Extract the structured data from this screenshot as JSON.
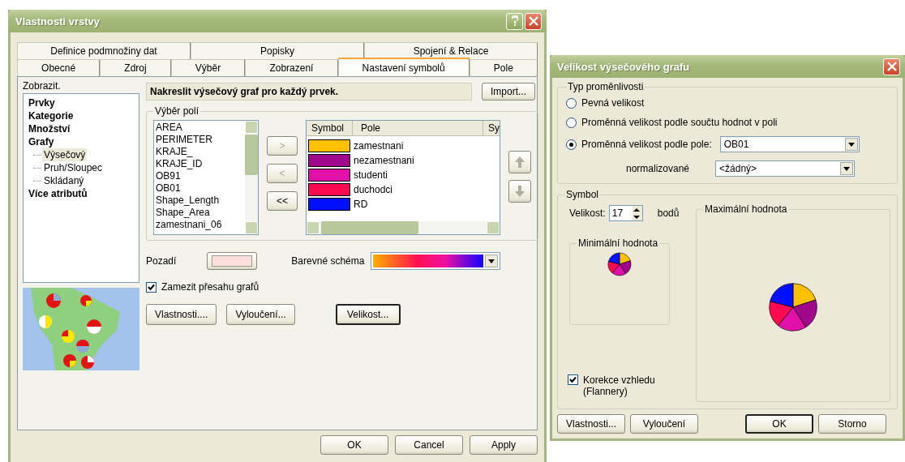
{
  "layer_dialog": {
    "title": "Vlastnosti vrstvy",
    "tab_rows": [
      [
        {
          "label": "Definice podmnožiny dat",
          "selected": false
        },
        {
          "label": "Popisky",
          "selected": false
        },
        {
          "label": "Spojení & Relace",
          "selected": false
        }
      ],
      [
        {
          "label": "Obecné",
          "selected": false
        },
        {
          "label": "Zdroj",
          "selected": false
        },
        {
          "label": "Výběr",
          "selected": false
        },
        {
          "label": "Zobrazení",
          "selected": false
        },
        {
          "label": "Nastavení symbolů",
          "selected": true
        },
        {
          "label": "Pole",
          "selected": false
        }
      ]
    ],
    "show_label": "Zobrazit.",
    "tree": [
      {
        "label": "Prvky",
        "selected": false
      },
      {
        "label": "Kategorie",
        "selected": false
      },
      {
        "label": "Množství",
        "selected": false
      },
      {
        "label": "Grafy",
        "selected": false,
        "children": [
          {
            "label": "Výsečový",
            "selected": true
          },
          {
            "label": "Pruh/Sloupec",
            "selected": false
          },
          {
            "label": "Skládaný",
            "selected": false
          }
        ]
      },
      {
        "label": "Více atributů",
        "selected": false
      }
    ],
    "heading": "Nakreslit výsečový graf pro každý prvek.",
    "import_button": "Import...",
    "field_group": "Výběr polí",
    "fields": [
      "AREA",
      "PERIMETER",
      "KRAJE_",
      "KRAJE_ID",
      "OB91",
      "OB01",
      "Shape_Length",
      "Shape_Area",
      "zamestnani_06"
    ],
    "move_buttons": [
      {
        "label": ">",
        "disabled": true
      },
      {
        "label": "<",
        "disabled": true
      },
      {
        "label": "<<",
        "disabled": false
      }
    ],
    "symbol_columns": [
      "Symbol",
      "Pole",
      "Sy"
    ],
    "symbols": [
      {
        "name": "zamestnani",
        "color": "#ffc000"
      },
      {
        "name": "nezamestnani",
        "color": "#a0088c"
      },
      {
        "name": "studenti",
        "color": "#e010a8"
      },
      {
        "name": "duchodci",
        "color": "#ff0a50"
      },
      {
        "name": "RD",
        "color": "#0010ff"
      }
    ],
    "background_label": "Pozadí",
    "scheme_label": "Barevné schéma",
    "overlap_checkbox": {
      "label": "Zamezit přesahu grafů",
      "checked": true
    },
    "buttons": [
      {
        "label": "Vlastnosti....",
        "default": false
      },
      {
        "label": "Vyloučení...",
        "default": false
      },
      {
        "label": "Velikost...",
        "default": true
      }
    ],
    "footer_buttons": [
      "OK",
      "Cancel",
      "Apply"
    ]
  },
  "size_dialog": {
    "title": "Velikost výsečového grafu",
    "type_group": "Typ proměnlivosti",
    "radios": [
      {
        "label": "Pevná velikost",
        "selected": false
      },
      {
        "label": "Proměnná velikost podle součtu hodnot v poli",
        "selected": false
      },
      {
        "label": "Proměnná velikost podle pole:",
        "selected": true
      }
    ],
    "field_value": "OB01",
    "normalize_label": "normalizované",
    "normalize_value": "<žádný>",
    "symbol_group": "Symbol",
    "size_label": "Velikost:",
    "size_value": "17",
    "size_unit": "bodů",
    "min_group": "Minimální hodnota",
    "max_group": "Maximální hodnota",
    "flannery_checkbox": {
      "label": "Korekce vzhledu (Flannery)",
      "checked": true
    },
    "buttons": [
      {
        "label": "Vlastnosti...",
        "default": false
      },
      {
        "label": "Vyloučení",
        "default": false
      },
      {
        "label": "OK",
        "default": true
      },
      {
        "label": "Storno",
        "default": false
      }
    ]
  }
}
